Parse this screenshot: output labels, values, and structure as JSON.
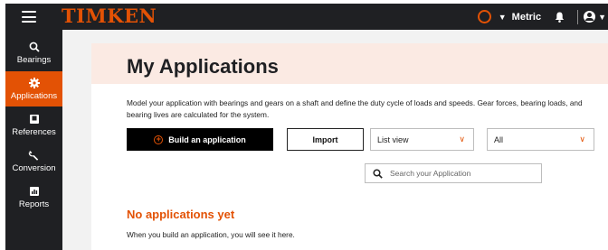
{
  "brand": {
    "logo_text": "TIMKEN",
    "accent": "#e35205",
    "dark": "#1f2023"
  },
  "topbar": {
    "units_label": "Metric",
    "icons": [
      "menu-icon",
      "status-ring-icon",
      "chevron-down-icon",
      "bell-icon",
      "user-icon"
    ]
  },
  "sidebar": {
    "items": [
      {
        "label": "Bearings",
        "icon": "bearing-search-icon",
        "active": false
      },
      {
        "label": "Applications",
        "icon": "gear-icon",
        "active": true
      },
      {
        "label": "References",
        "icon": "book-icon",
        "active": false
      },
      {
        "label": "Conversion",
        "icon": "wrench-icon",
        "active": false
      },
      {
        "label": "Reports",
        "icon": "bar-chart-icon",
        "active": false
      }
    ]
  },
  "main": {
    "title": "My Applications",
    "description": "Model your application with bearings and gears on a shaft and define the duty cycle of loads and speeds. Gear forces, bearing loads, and bearing lives are calculated for the system.",
    "build_button": "Build an application",
    "import_button": "Import",
    "view_select": "List view",
    "filter_select": "All",
    "search_placeholder": "Search your Application",
    "empty_title": "No applications yet",
    "empty_message": "When you build an application, you will see it here."
  }
}
